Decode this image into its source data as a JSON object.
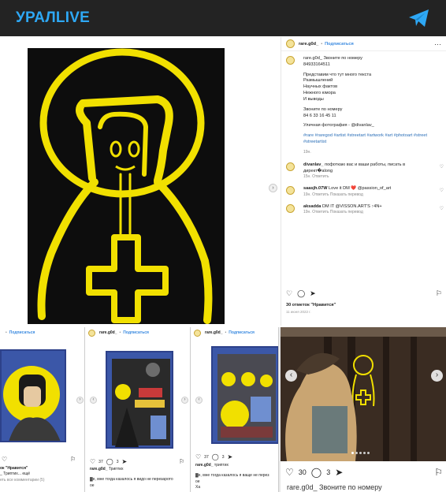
{
  "header": {
    "brand": "УРАЛLIVE",
    "telegram_icon": "telegram-plane-icon",
    "brand_color": "#2ea8f5",
    "bar_color": "#232323"
  },
  "post": {
    "username": "rare.g0d_",
    "follow_label": "Подписаться",
    "caption_lines": "rare.g0d_ Звоните по номеру\n84933164511",
    "caption_body": "Представим что тут много текста\nРазмышлений\nНаучных фактов\nНежного юмора\nИ выводы",
    "caption_call": "Звоните по номеру\n84 6 33 16 45 11",
    "caption_credit": "Уличная фотография - @divanlav_",
    "tags": "#rare #raregod #artist #streetart #artwork #art #photoart #street #streetartist",
    "caption_meta": "19н.",
    "comments": [
      {
        "user": "divanlav_",
        "text": "пофоткаю вас и ваши работы, писать в директ�along",
        "meta": "15н.   Ответить"
      },
      {
        "user": "saasjh.07W",
        "text": "Love it DM ❤️ @passion_of_art",
        "meta": "19н.   Ответить   Показать перевод"
      },
      {
        "user": "aksadda",
        "text": "DM IT @VISSON.ART'S ↑4N+",
        "meta": "19н.   Ответить   Показать перевод"
      }
    ],
    "likes": "30 отметок \"Нравится\"",
    "date": "11 июня 2022 г."
  },
  "cards": [
    {
      "follow": "Подписаться",
      "likes_line": "ок \"Нравится\"",
      "caption": "_ Триптих... ещё",
      "comments_link": "еть все комментарии (5)"
    },
    {
      "user": "rare.g0d_",
      "follow": "Подписаться",
      "likes": "37",
      "comments": "3",
      "username": "rare.g0d_",
      "caption": "Триптих",
      "extra": "▓е, мне тогда казалось я видо не перезарото\nое"
    },
    {
      "user": "rare.g0d_",
      "follow": "Подписаться",
      "likes": "37",
      "comments": "3",
      "username": "rare.g0d_",
      "caption": "триптих",
      "extra": "▓е, мне тогда казалось я ваще не перез\nое\nХа"
    }
  ],
  "street_post": {
    "likes": "30",
    "comments": "3",
    "caption": "rare.g0d_ Звоните по номеру"
  }
}
